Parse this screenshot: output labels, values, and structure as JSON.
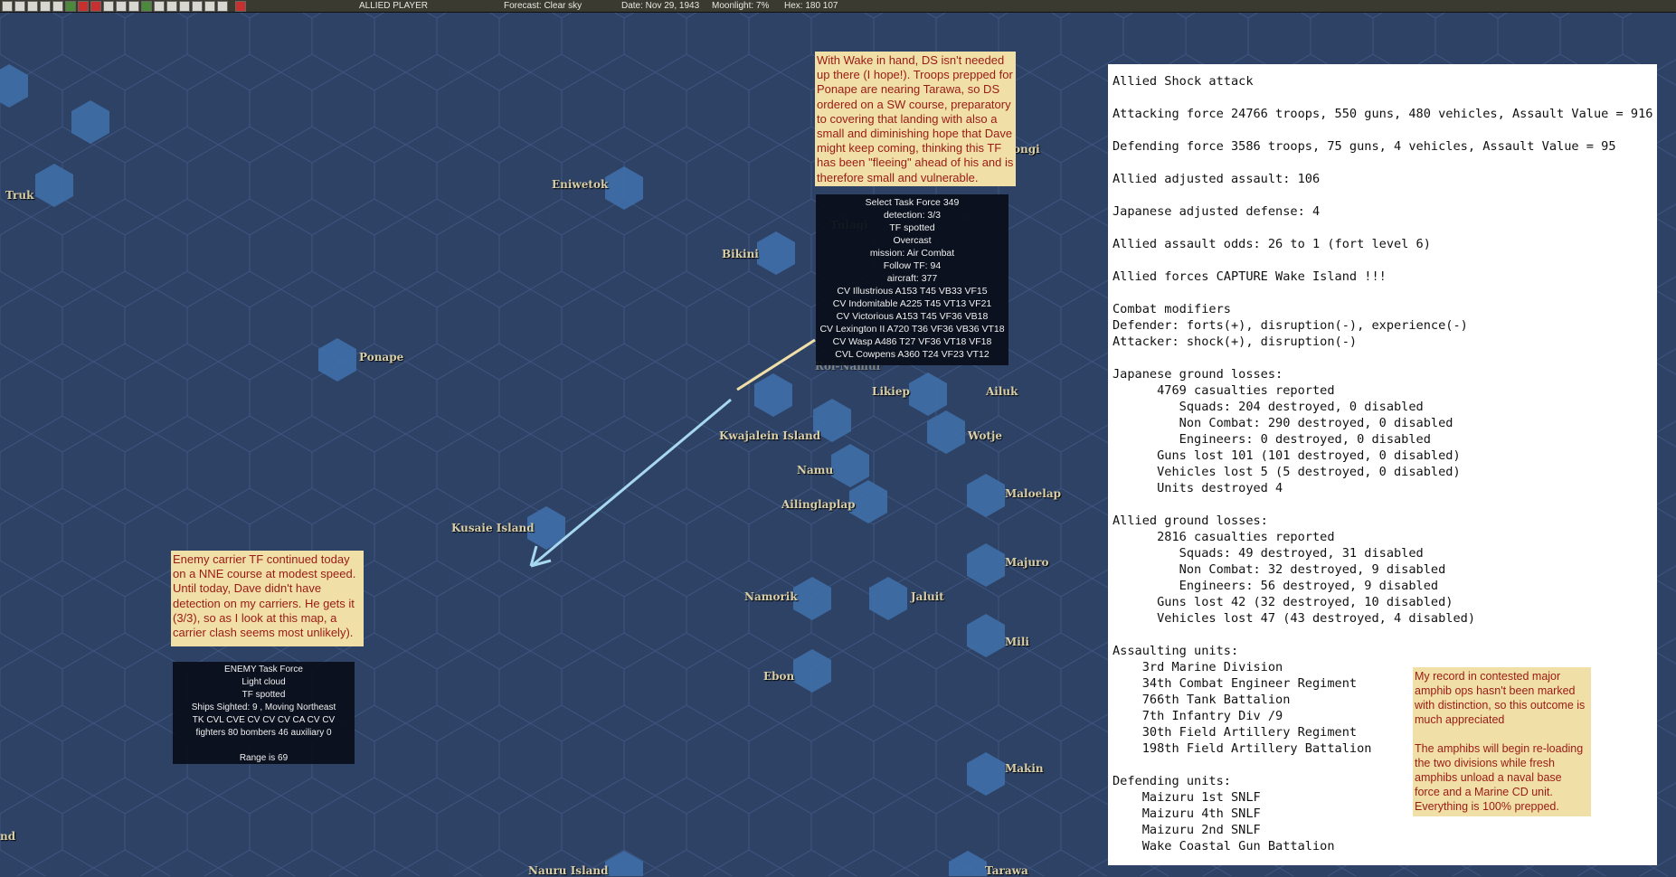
{
  "topbar": {
    "player": "ALLIED PLAYER",
    "forecast": "Forecast: Clear sky",
    "date": "Date: Nov 29, 1943",
    "moonlight": "Moonlight: 7%",
    "hex": "Hex: 180 107"
  },
  "map_labels": [
    "Truk",
    "Eniwetok",
    "Bikini",
    "Ponape",
    "Kwajalein Island",
    "Likiep",
    "Ailuk",
    "Wotje",
    "Namu",
    "Ailinglaplap",
    "Maloelap",
    "Kusaie Island",
    "Majuro",
    "Namorik",
    "Jaluit",
    "Mili",
    "Ebon",
    "Makin",
    "Nauru Island",
    "Tarawa",
    "nd",
    "ongi",
    "Tulagi",
    "Roi-Namur"
  ],
  "notes": {
    "wake": "With Wake in hand, DS isn't needed up there (I hope!).  Troops prepped for Ponape are nearing Tarawa, so DS ordered on a SW course, preparatory to covering that landing with also a small and diminishing hope that Dave might keep coming, thinking this TF has been \"fleeing\" ahead of his and is therefore small and vulnerable.",
    "enemy": "Enemy carrier TF continued today on a NNE course at modest speed.  Until today, Dave didn't have detection on my carriers.  He gets it (3/3), so as I look at this map, a carrier clash seems most unlikely).",
    "record1": "My record in contested major amphib ops hasn't been marked with distinction, so this outcome is much appreciated",
    "record2": "The amphibs will begin re-loading the two divisions while fresh amphibs unload a naval base force and a Marine CD unit. Everything is 100% prepped."
  },
  "own_tf": [
    "Select Task Force 349",
    "detection: 3/3",
    "TF spotted",
    "Overcast",
    "mission: Air Combat",
    "Follow TF: 94",
    "aircraft: 377",
    "CV Illustrious A153  T45  VB33  VF15",
    "CV Indomitable A225  T45  VT13  VF21",
    "CV Victorious A153  T45  VF36  VB18",
    "CV Lexington II A720  T36  VF36  VB36  VT18",
    "CV Wasp A486  T27  VF36  VT18  VF18",
    "CVL Cowpens A360  T24  VF23  VT12"
  ],
  "enemy_tf": [
    "ENEMY Task Force",
    "Light cloud",
    "TF spotted",
    "Ships Sighted: 9 , Moving Northeast",
    "TK CVL CVE CV CV CV CA CV CV",
    "fighters 80   bombers 46   auxiliary 0",
    "",
    "Range is 69"
  ],
  "report": [
    "Allied Shock attack",
    "",
    "Attacking force 24766 troops, 550 guns, 480 vehicles, Assault Value = 916",
    "",
    "Defending force 3586 troops, 75 guns, 4 vehicles, Assault Value = 95",
    "",
    "Allied adjusted assault: 106",
    "",
    "Japanese adjusted defense: 4",
    "",
    "Allied assault odds: 26 to 1 (fort level 6)",
    "",
    "Allied forces CAPTURE Wake Island !!!",
    "",
    "Combat modifiers",
    "Defender: forts(+), disruption(-), experience(-)",
    "Attacker: shock(+), disruption(-)",
    "",
    "Japanese ground losses:",
    "      4769 casualties reported",
    "         Squads: 204 destroyed, 0 disabled",
    "         Non Combat: 290 destroyed, 0 disabled",
    "         Engineers: 0 destroyed, 0 disabled",
    "      Guns lost 101 (101 destroyed, 0 disabled)",
    "      Vehicles lost 5 (5 destroyed, 0 disabled)",
    "      Units destroyed 4",
    "",
    "Allied ground losses:",
    "      2816 casualties reported",
    "         Squads: 49 destroyed, 31 disabled",
    "         Non Combat: 32 destroyed, 9 disabled",
    "         Engineers: 56 destroyed, 9 disabled",
    "      Guns lost 42 (32 destroyed, 10 disabled)",
    "      Vehicles lost 47 (43 destroyed, 4 disabled)",
    "",
    "Assaulting units:",
    "    3rd Marine Division",
    "    34th Combat Engineer Regiment",
    "    766th Tank Battalion",
    "    7th Infantry Div /9",
    "    30th Field Artillery Regiment",
    "    198th Field Artillery Battalion",
    "",
    "Defending units:",
    "    Maizuru 1st SNLF",
    "    Maizuru 4th SNLF",
    "    Maizuru 2nd SNLF",
    "    Wake Coastal Gun Battalion"
  ],
  "colors": {
    "ocean": "#2e4266",
    "note_bg": "#f0e0a8",
    "note_text": "#9a1a14",
    "arrow": "#a8d8f0"
  }
}
